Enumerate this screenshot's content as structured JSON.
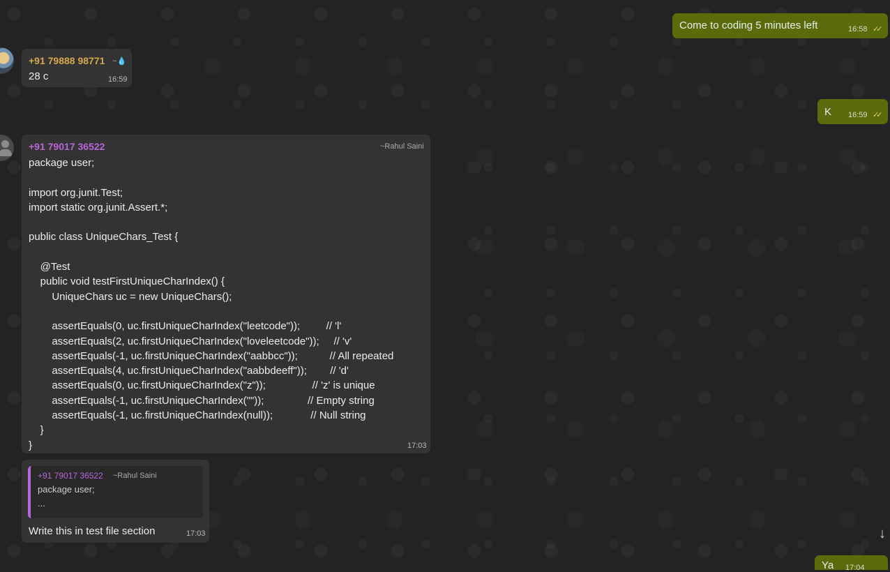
{
  "colors": {
    "background": "#232323",
    "incoming_bubble": "#333333",
    "outgoing_bubble": "#5a6b0c",
    "sender1_color": "#d6a84a",
    "sender2_color": "#b866d9",
    "read_ticks": "#e3d46a"
  },
  "messages": [
    {
      "direction": "outgoing",
      "text": "Come to coding 5 minutes left",
      "time": "16:58",
      "status_icon": "double-check-icon"
    },
    {
      "direction": "incoming",
      "sender": "+91 79888 98771",
      "alias": "~",
      "alias_icon": "drop-icon",
      "text": "28 c",
      "time": "16:59"
    },
    {
      "direction": "outgoing",
      "text": "K",
      "time": "16:59",
      "status_icon": "double-check-icon"
    },
    {
      "direction": "incoming",
      "sender": "+91 79017 36522",
      "alias": "~Rahul Saini",
      "code_lines": [
        "package user;",
        "",
        "import org.junit.Test;",
        "import static org.junit.Assert.*;",
        "",
        "public class UniqueChars_Test {",
        "",
        "    @Test",
        "    public void testFirstUniqueCharIndex() {",
        "        UniqueChars uc = new UniqueChars();",
        "",
        "        assertEquals(0, uc.firstUniqueCharIndex(\"leetcode\"));         // 'l'",
        "        assertEquals(2, uc.firstUniqueCharIndex(\"loveleetcode\"));     // 'v'",
        "        assertEquals(-1, uc.firstUniqueCharIndex(\"aabbcc\"));           // All repeated",
        "        assertEquals(4, uc.firstUniqueCharIndex(\"aabbdeeff\"));        // 'd'",
        "        assertEquals(0, uc.firstUniqueCharIndex(\"z\"));                // 'z' is unique",
        "        assertEquals(-1, uc.firstUniqueCharIndex(\"\"));               // Empty string",
        "        assertEquals(-1, uc.firstUniqueCharIndex(null));             // Null string",
        "    }",
        "}"
      ],
      "time": "17:03"
    },
    {
      "direction": "incoming",
      "quoted": {
        "sender": "+91 79017 36522",
        "alias": "~Rahul Saini",
        "line1": "package user;",
        "line2": "..."
      },
      "text": "Write this in test file section",
      "time": "17:03"
    },
    {
      "direction": "outgoing",
      "text": "Ya",
      "time": "17:04"
    }
  ],
  "scroll_down_icon": "arrow-down-icon"
}
